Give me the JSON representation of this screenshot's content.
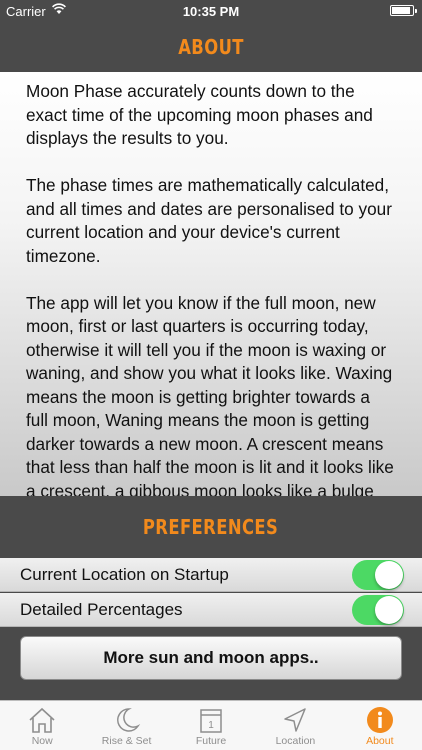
{
  "status_bar": {
    "carrier": "Carrier",
    "time": "10:35 PM"
  },
  "about": {
    "title": "ABOUT",
    "paragraphs": [
      "Moon Phase accurately counts down to the exact time of the upcoming moon phases and displays the results to you.",
      "The phase times are mathematically calculated, and all times and dates are personalised to your current location and your device's current timezone.",
      "The app will let you know if the full moon, new moon, first or last quarters is occurring today, otherwise it will tell you if the moon is waxing or waning, and show you what it looks like. Waxing means the moon is getting brighter towards a full moon, Waning means the moon is getting darker towards a new moon. A crescent means that less than half the moon is lit and it looks like a crescent, a gibbous moon looks like a bulge and more than half is lit up."
    ]
  },
  "preferences": {
    "title": "PREFERENCES",
    "items": [
      {
        "label": "Current Location on Startup",
        "enabled": true
      },
      {
        "label": "Detailed Percentages",
        "enabled": true
      }
    ],
    "apps_button": "More sun and moon apps.."
  },
  "tabs": [
    {
      "label": "Now",
      "icon": "home-icon",
      "active": false
    },
    {
      "label": "Rise & Set",
      "icon": "moon-icon",
      "active": false
    },
    {
      "label": "Future",
      "icon": "calendar-icon",
      "calendar_day": "1",
      "active": false
    },
    {
      "label": "Location",
      "icon": "location-arrow-icon",
      "active": false
    },
    {
      "label": "About",
      "icon": "info-icon",
      "active": true
    }
  ],
  "colors": {
    "accent": "#f28a1c",
    "toggle_on": "#4cd964",
    "chrome": "#4a4a4a"
  }
}
